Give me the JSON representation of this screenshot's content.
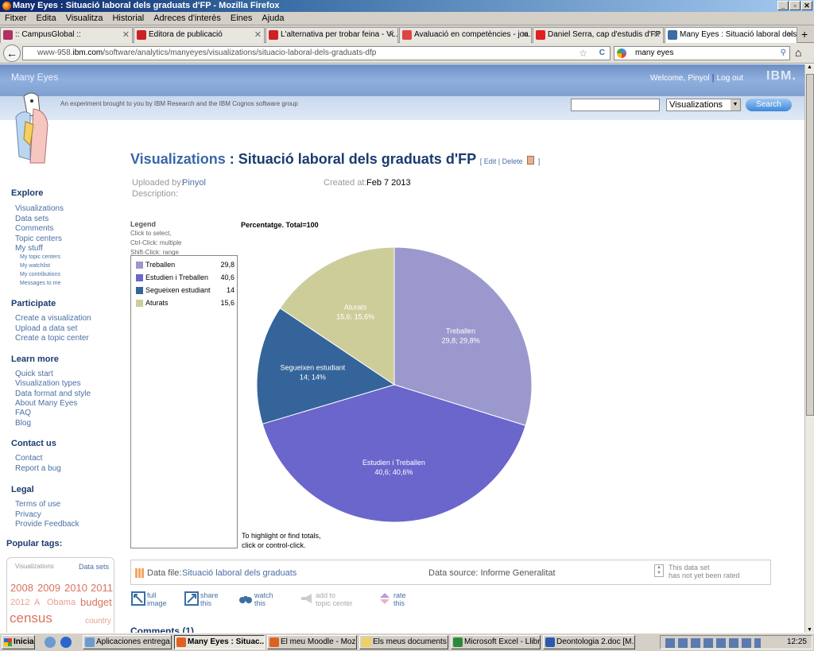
{
  "window": {
    "title": "Many Eyes : Situació laboral dels graduats d'FP - Mozilla Firefox",
    "min": "_",
    "max": "▫",
    "close": "✕"
  },
  "menu": [
    "Fitxer",
    "Edita",
    "Visualitza",
    "Historial",
    "Adreces d'interès",
    "Eines",
    "Ajuda"
  ],
  "tabs": [
    {
      "label": ":: CampusGlobal ::",
      "color": "#b03060"
    },
    {
      "label": "Editora de publicació",
      "color": "#cc2222"
    },
    {
      "label": "L'alternativa per trobar feina - Vi...",
      "color": "#cc2222"
    },
    {
      "label": "Avaluació en competències - joa...",
      "color": "#d44"
    },
    {
      "label": "Daniel Serra, cap d'estudis d'FP ...",
      "color": "#e02020"
    },
    {
      "label": "Many Eyes : Situació laboral dels...",
      "color": "#3a6ea5"
    }
  ],
  "tab_close": "✕",
  "new_tab": "+",
  "nav": {
    "back": "←",
    "url_pre": "www-958.",
    "url_host": "ibm.com",
    "url_rest": "/software/analytics/manyeyes/visualizations/situacio-laboral-dels-graduats-dfp",
    "search": "many eyes",
    "home": "⌂",
    "star": "☆",
    "reload": "C"
  },
  "site": {
    "brand": "Many Eyes",
    "welcome": "Welcome,",
    "user": "Pinyol",
    "logout": "Log out",
    "ibm": "IBM.",
    "tagline": "An experiment brought to you by IBM Research and the IBM Cognos software group",
    "select": "Visualizations",
    "dd": "▼",
    "search_btn": "Search"
  },
  "sidebar": {
    "explore": "Explore",
    "explore_items": [
      "Visualizations",
      "Data sets",
      "Comments",
      "Topic centers",
      "My stuff"
    ],
    "mystuff": [
      "My topic centers",
      "My watchlist",
      "My contributions",
      "Messages to me"
    ],
    "participate": "Participate",
    "participate_items": [
      "Create a visualization",
      "Upload a data set",
      "Create a topic center"
    ],
    "learn": "Learn more",
    "learn_items": [
      "Quick start",
      "Visualization types",
      "Data format and style",
      "About Many Eyes",
      "FAQ",
      "Blog"
    ],
    "contact": "Contact us",
    "contact_items": [
      "Contact",
      "Report a bug"
    ],
    "legal": "Legal",
    "legal_items": [
      "Terms of use",
      "Privacy",
      "Provide Feedback"
    ],
    "popular": "Popular tags:",
    "tag_tabs": [
      "Visualizations",
      "Data sets"
    ],
    "tags": [
      "2008",
      "2009",
      "2010",
      "2011",
      "2012",
      "A",
      "Obama",
      "budget",
      "census",
      "country"
    ]
  },
  "viz": {
    "prefix": "Visualizations",
    "sep": ":",
    "title": "Situació laboral dels graduats d'FP",
    "edit": "[ Edit | Delete",
    "edit_close": "]",
    "uploaded_by_label": "Uploaded by:",
    "uploaded_by": "Pinyol",
    "description_label": "Description:",
    "created_label": "Created at:",
    "created": "Feb 7 2013"
  },
  "legend": {
    "title": "Legend",
    "l1": "Click to select,",
    "l2": "Ctrl-Click: multiple",
    "l3": "Shift-Click: range"
  },
  "chart_data": {
    "type": "pie",
    "title": "Percentatge. Total=100",
    "slices": [
      {
        "label": "Treballen",
        "value": 29.8,
        "display": "29,8",
        "slice_label": "29,8; 29,8%",
        "color": "#9a98cc"
      },
      {
        "label": "Estudien i Treballen",
        "value": 40.6,
        "display": "40,6",
        "slice_label": "40,6; 40,6%",
        "color": "#6a66cc"
      },
      {
        "label": "Segueixen estudiant",
        "value": 14,
        "display": "14",
        "slice_label": "14; 14%",
        "color": "#34649a"
      },
      {
        "label": "Aturats",
        "value": 15.6,
        "display": "15,6",
        "slice_label": "15,6; 15,6%",
        "color": "#cdcd9a"
      }
    ]
  },
  "pie_note": {
    "l1": "To highlight or find totals,",
    "l2": "click or control-click."
  },
  "datafile": {
    "label": "Data file:",
    "name": "Situació laboral dels graduats",
    "source_label": "Data source:",
    "source": "Informe Generalitat",
    "rating1": "This data set",
    "rating2": "has not yet been rated"
  },
  "actions": [
    {
      "l1": "full",
      "l2": "image"
    },
    {
      "l1": "share",
      "l2": "this"
    },
    {
      "l1": "watch",
      "l2": "this"
    },
    {
      "l1": "add to",
      "l2": "topic center"
    },
    {
      "l1": "rate",
      "l2": "this"
    }
  ],
  "comments": "Comments (1)",
  "taskbar": {
    "start": "Inicia",
    "items": [
      "Aplicaciones entrega...",
      "Many Eyes : Situac...",
      "El meu Moodle - Mozill...",
      "Els meus documents",
      "Microsoft Excel - Llibre1",
      "Deontologia 2.doc [M..."
    ],
    "clock": "12:25"
  }
}
